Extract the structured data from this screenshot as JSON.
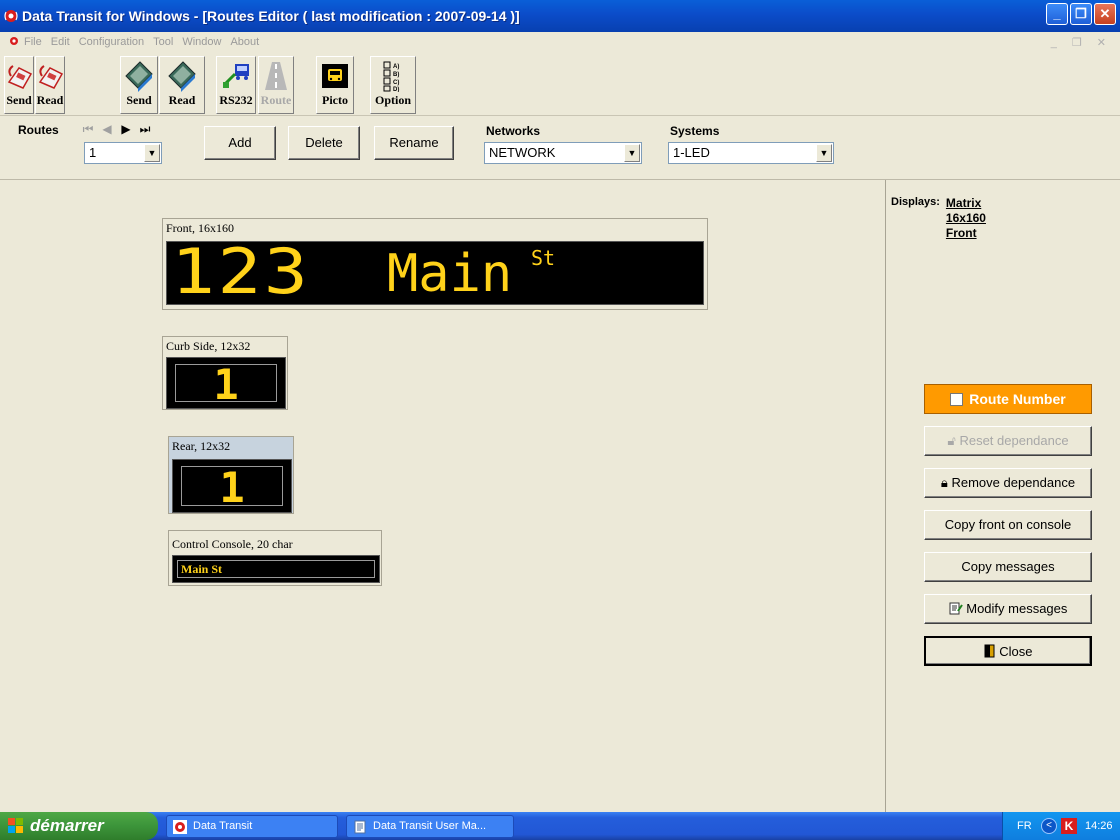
{
  "window": {
    "title": "Data Transit for Windows - [Routes Editor ( last modification : 2007-09-14 )]"
  },
  "menu": [
    "File",
    "Edit",
    "Configuration",
    "Tool",
    "Window",
    "About"
  ],
  "toolbar": {
    "send1": "Send",
    "read1": "Read",
    "send2": "Send",
    "read2": "Read",
    "rs232": "RS232",
    "route": "Route",
    "picto": "Picto",
    "option": "Option"
  },
  "routes": {
    "label": "Routes",
    "selected": "1",
    "add": "Add",
    "delete": "Delete",
    "rename": "Rename"
  },
  "networks": {
    "label": "Networks",
    "selected": "NETWORK"
  },
  "systems": {
    "label": "Systems",
    "selected": "1-LED"
  },
  "signs": {
    "front": {
      "caption": "Front, 16x160",
      "number": "123",
      "text": "Main",
      "suffix": "St"
    },
    "curb": {
      "caption": "Curb Side, 12x32",
      "text": "1"
    },
    "rear": {
      "caption": "Rear, 12x32",
      "text": "1"
    },
    "console": {
      "caption": "Control Console, 20 char",
      "text": "Main St"
    }
  },
  "panel": {
    "displays_label": "Displays:",
    "display_line1": "Matrix",
    "display_line2": "16x160",
    "display_line3": "Front",
    "route_number": "Route Number",
    "reset_dependance": "Reset dependance",
    "remove_dependance": "Remove dependance",
    "copy_front": "Copy front on console",
    "copy_messages": "Copy messages",
    "modify_messages": "Modify messages",
    "close": "Close"
  },
  "taskbar": {
    "start": "démarrer",
    "item1": "Data Transit",
    "item2": "Data Transit User Ma...",
    "lang": "FR",
    "clock": "14:26"
  },
  "colors": {
    "led": "#ffd21a",
    "route_number_bg": "#ff9a00",
    "titlebar": "#0b4cc9"
  }
}
